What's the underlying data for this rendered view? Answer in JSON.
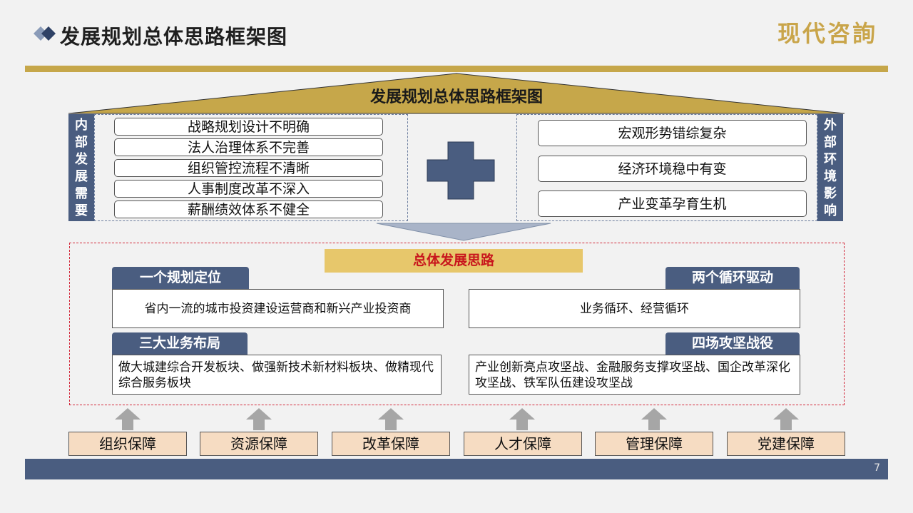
{
  "header": {
    "title": "发展规划总体思路框架图",
    "logo_text": "现代咨詢"
  },
  "roof": {
    "title": "发展规划总体思路框架图"
  },
  "internal": {
    "label": "内部发展需要",
    "items": [
      "战略规划设计不明确",
      "法人治理体系不完善",
      "组织管控流程不清晰",
      "人事制度改革不深入",
      "薪酬绩效体系不健全"
    ]
  },
  "external": {
    "label": "外部环境影响",
    "items": [
      "宏观形势错综复杂",
      "经济环境稳中有变",
      "产业变革孕育生机"
    ]
  },
  "overall": {
    "heading": "总体发展思路",
    "positioning": {
      "tag": "一个规划定位",
      "text": "省内一流的城市投资建设运营商和新兴产业投资商"
    },
    "cycles": {
      "tag": "两个循环驱动",
      "text": "业务循环、经营循环"
    },
    "layout": {
      "tag": "三大业务布局",
      "text": "做大城建综合开发板块、做强新技术新材料板块、做精现代综合服务板块"
    },
    "battles": {
      "tag": "四场攻坚战役",
      "text": "产业创新亮点攻坚战、金融服务支撑攻坚战、国企改革深化攻坚战、铁军队伍建设攻坚战"
    }
  },
  "pillars": [
    "组织保障",
    "资源保障",
    "改革保障",
    "人才保障",
    "管理保障",
    "党建保障"
  ],
  "footer": {
    "page_number": "7"
  },
  "colors": {
    "navy": "#4a5d80",
    "gold": "#c6a74a",
    "red": "#d3283a",
    "peach": "#f6dcc2"
  }
}
